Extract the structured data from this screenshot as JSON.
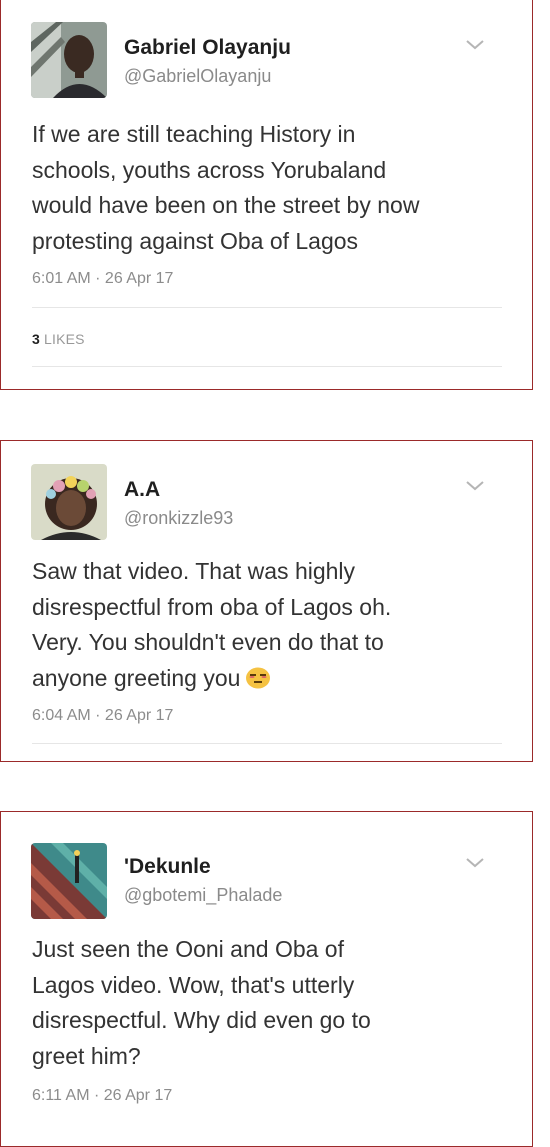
{
  "tweets": [
    {
      "name": "Gabriel Olayanju",
      "handle": "@GabrielOlayanju",
      "lines": [
        "If we are still teaching History in",
        "schools, youths across Yorubaland",
        "would have been on the street by now",
        "protesting against Oba of Lagos"
      ],
      "time": "6:01 AM · 26 Apr 17",
      "likes_count": "3",
      "likes_label": "LIKES"
    },
    {
      "name": "A.A",
      "handle": "@ronkizzle93",
      "lines": [
        "Saw that video. That was highly",
        "disrespectful from oba of Lagos oh.",
        "Very. You shouldn't even do that to",
        "anyone greeting you"
      ],
      "emoji": "unamused-face-emoji",
      "time": "6:04 AM · 26 Apr 17"
    },
    {
      "name": "'Dekunle",
      "handle": "@gbotemi_Phalade",
      "lines": [
        "Just seen the Ooni and Oba of",
        "Lagos video. Wow, that's utterly",
        "disrespectful. Why did even go to",
        "greet him?"
      ],
      "time": "6:11 AM · 26 Apr 17"
    }
  ],
  "icons": {
    "menu": "chevron-down-icon"
  },
  "colors": {
    "card_border": "#9b2a2a",
    "muted": "#8a8a8a"
  }
}
